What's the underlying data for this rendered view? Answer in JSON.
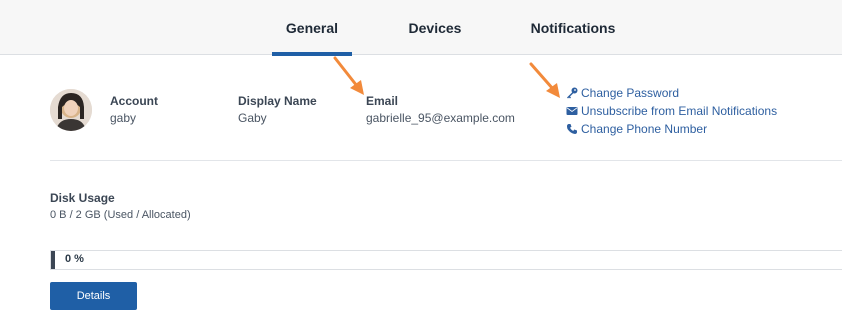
{
  "tabs": [
    {
      "label": "General",
      "active": true
    },
    {
      "label": "Devices",
      "active": false
    },
    {
      "label": "Notifications",
      "active": false
    }
  ],
  "profile": {
    "account_label": "Account",
    "account_value": "gaby",
    "display_name_label": "Display Name",
    "display_name_value": "Gaby",
    "email_label": "Email",
    "email_value": "gabrielle_95@example.com"
  },
  "actions": {
    "change_password": {
      "label": "Change Password",
      "icon": "key-icon"
    },
    "unsubscribe": {
      "label": "Unsubscribe from Email Notifications",
      "icon": "envelope-icon"
    },
    "change_phone": {
      "label": "Change Phone Number",
      "icon": "phone-icon"
    }
  },
  "disk": {
    "title": "Disk Usage",
    "detail": "0 B / 2 GB (Used / Allocated)",
    "progress_text": "0 %",
    "progress_fraction": 0.0,
    "details_button": "Details"
  },
  "colors": {
    "accent": "#1f5fa6",
    "link": "#2e5fa0",
    "annotation_arrow": "#f28a3b"
  }
}
